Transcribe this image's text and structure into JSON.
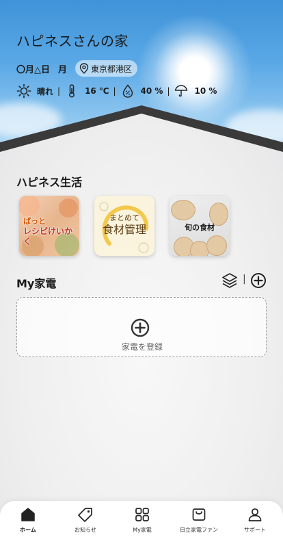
{
  "header": {
    "home_title": "ハピネスさんの家",
    "date": "〇月△日",
    "weekday": "月",
    "location": "東京都港区",
    "weather": {
      "condition": "晴れ",
      "temperature": "16 ℃",
      "precip_humidity": "40 %",
      "rain_chance": "10 %"
    }
  },
  "happiness_life": {
    "title": "ハピネス生活",
    "cards": [
      {
        "label_line1": "ぱっと",
        "label_line2": "レシピけいかく"
      },
      {
        "label_line1": "まとめて",
        "label_line2": "食材管理"
      },
      {
        "label_line1": "旬の食材"
      }
    ]
  },
  "my_kaden": {
    "title": "My家電",
    "separator": "|",
    "register_label": "家電を登録"
  },
  "bottom_nav": {
    "items": [
      {
        "label": "ホーム",
        "icon": "home-icon"
      },
      {
        "label": "お知らせ",
        "icon": "tag-icon"
      },
      {
        "label": "My家電",
        "icon": "grid-icon"
      },
      {
        "label": "日立家電ファン",
        "icon": "bag-icon"
      },
      {
        "label": "サポート",
        "icon": "user-icon"
      }
    ]
  },
  "colors": {
    "sky_top": "#3f93d8",
    "roof": "#3a3a3a",
    "text_primary": "#1a1a1a"
  }
}
